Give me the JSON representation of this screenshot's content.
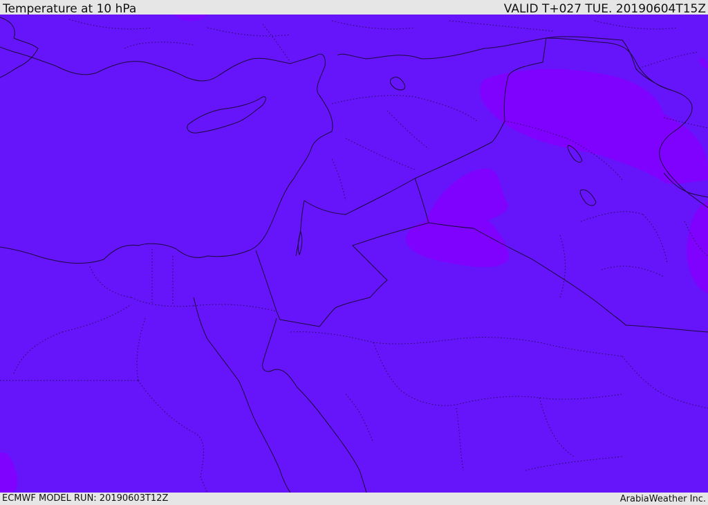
{
  "header": {
    "title": "Temperature at 10 hPa",
    "valid": "VALID T+027 TUE. 20190604T15Z"
  },
  "footer": {
    "model_run": "ECMWF MODEL RUN: 20190603T12Z",
    "credit": "ArabiaWeather Inc."
  },
  "colors": {
    "base_field": "#6614fa",
    "warm_patch": "#8200ff",
    "boundary": "#1a0a3a",
    "frame": "#e6e6e6"
  }
}
